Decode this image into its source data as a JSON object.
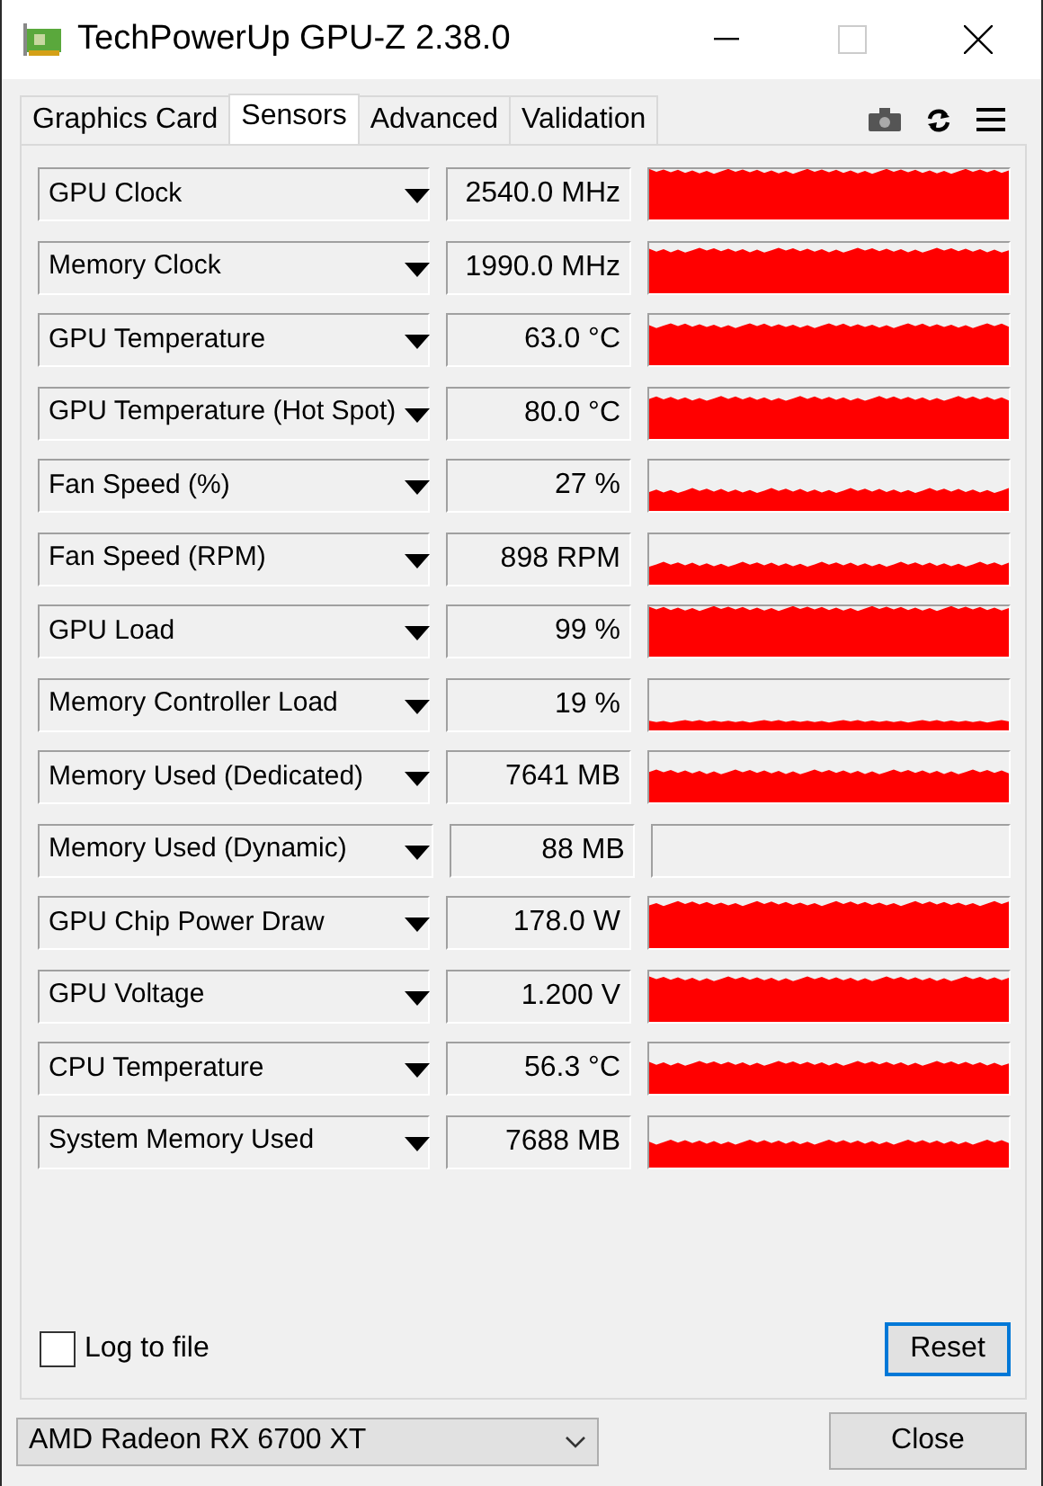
{
  "window": {
    "title": "TechPowerUp GPU-Z 2.38.0"
  },
  "tabs": [
    {
      "label": "Graphics Card",
      "selected": false
    },
    {
      "label": "Sensors",
      "selected": true
    },
    {
      "label": "Advanced",
      "selected": false
    },
    {
      "label": "Validation",
      "selected": false
    }
  ],
  "sensors": [
    {
      "name": "GPU Clock",
      "value": "2540.0 MHz"
    },
    {
      "name": "Memory Clock",
      "value": "1990.0 MHz"
    },
    {
      "name": "GPU Temperature",
      "value": "63.0 °C"
    },
    {
      "name": "GPU Temperature (Hot Spot)",
      "value": "80.0 °C"
    },
    {
      "name": "Fan Speed (%)",
      "value": "27 %"
    },
    {
      "name": "Fan Speed (RPM)",
      "value": "898 RPM"
    },
    {
      "name": "GPU Load",
      "value": "99 %"
    },
    {
      "name": "Memory Controller Load",
      "value": "19 %"
    },
    {
      "name": "Memory Used (Dedicated)",
      "value": "7641 MB"
    },
    {
      "name": "Memory Used (Dynamic)",
      "value": "88 MB"
    },
    {
      "name": "GPU Chip Power Draw",
      "value": "178.0 W"
    },
    {
      "name": "GPU Voltage",
      "value": "1.200 V"
    },
    {
      "name": "CPU Temperature",
      "value": "56.3 °C"
    },
    {
      "name": "System Memory Used",
      "value": "7688 MB"
    }
  ],
  "log_to_file": {
    "label": "Log to file",
    "checked": false
  },
  "reset_button": "Reset",
  "device": "AMD Radeon RX 6700 XT",
  "close_button": "Close"
}
